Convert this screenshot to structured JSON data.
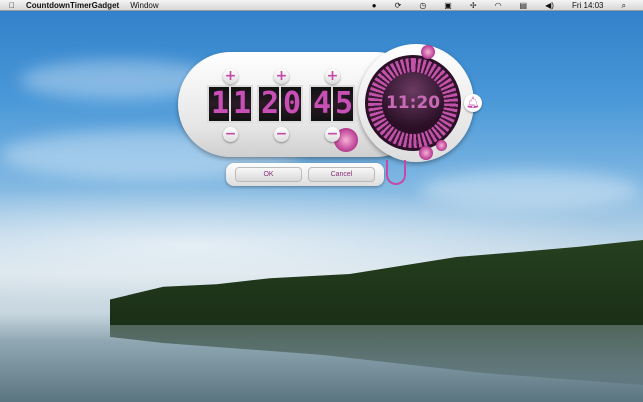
{
  "menubar": {
    "apple_icon": "apple-icon",
    "app_name": "CountdownTimerGadget",
    "menus": [
      "Window"
    ],
    "clock": "Fri 14:03",
    "status_icons": [
      "app-status-icon",
      "sync-icon",
      "time-machine-icon",
      "display-icon",
      "bluetooth-icon",
      "wifi-icon",
      "flag-icon",
      "volume-icon",
      "spotlight-icon"
    ]
  },
  "timer": {
    "hours": [
      "1",
      "1"
    ],
    "minutes": [
      "2",
      "0"
    ],
    "seconds": [
      "4",
      "5"
    ],
    "increment_label": "+",
    "decrement_label": "−",
    "dial_display": "11:20",
    "alarm_icon": "bell-icon"
  },
  "buttons": {
    "ok": "OK",
    "cancel": "Cancel"
  },
  "colors": {
    "accent": "#c54aa8"
  }
}
